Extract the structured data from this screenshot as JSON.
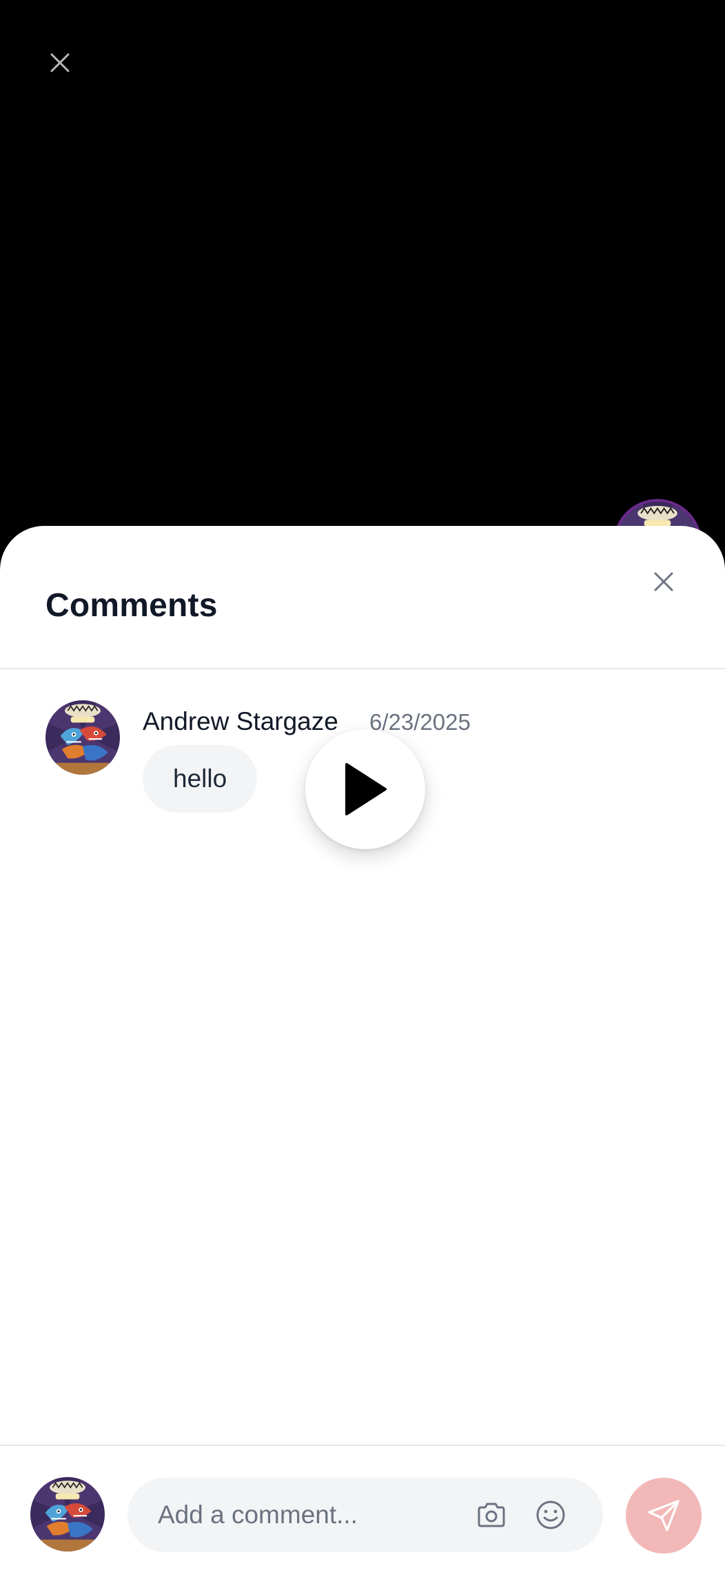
{
  "video": {
    "close_icon": "close-icon",
    "play_icon": "play-icon"
  },
  "comments_sheet": {
    "title": "Comments",
    "close_icon": "close-icon",
    "comments": [
      {
        "author": "Andrew Stargaze",
        "date": "6/23/2025",
        "text": "hello",
        "avatar_icon": "shark-cartoon-avatar"
      }
    ]
  },
  "composer": {
    "placeholder": "Add a comment...",
    "value": "",
    "icons": [
      "camera-icon",
      "smiley-face-icon",
      "send-icon"
    ]
  },
  "colors": {
    "backdrop": "#000000",
    "sheet": "#ffffff",
    "bubble": "#f3f4f6",
    "send_button_disabled": "#f2b8b8",
    "text_primary": "#111827",
    "text_secondary": "#6b7280"
  }
}
